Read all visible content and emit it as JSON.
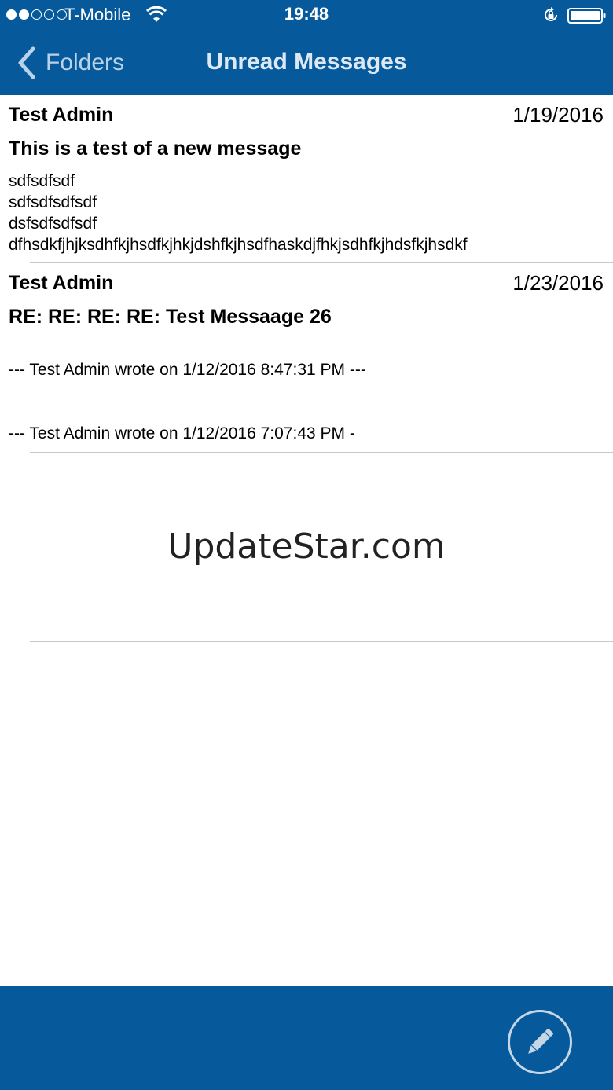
{
  "status_bar": {
    "signal_dots": [
      true,
      true,
      false,
      false,
      false
    ],
    "carrier": "T-Mobile",
    "time": "19:48"
  },
  "nav": {
    "back_label": "Folders",
    "title": "Unread Messages"
  },
  "messages": [
    {
      "sender": "Test Admin",
      "date": "1/19/2016",
      "subject": "This is a test of a new message",
      "body_lines": [
        "sdfsdfsdf",
        "sdfsdfsdfsdf",
        "dsfsdfsdfsdf",
        "dfhsdkfjhjksdhfkjhsdfkjhkjdshfkjhsdfhaskdjfhkjsdhfkjhdsfkjhsdkf"
      ]
    },
    {
      "sender": "Test Admin",
      "date": "1/23/2016",
      "subject": "RE: RE: RE: RE: Test Messaage 26",
      "body_lines": [
        "--- Test Admin wrote on 1/12/2016 8:47:31 PM ---",
        "--- Test Admin wrote on 1/12/2016 7:07:43 PM -"
      ]
    }
  ],
  "watermark": "UpdateStar.com",
  "colors": {
    "bar_blue": "#065a9c",
    "back_label": "#b8d2ea",
    "separator": "#c8c8cc"
  },
  "icons": {
    "back": "chevron-left-icon",
    "compose": "pencil-icon",
    "wifi": "wifi-icon",
    "lock": "orientation-lock-icon",
    "battery": "battery-icon"
  }
}
